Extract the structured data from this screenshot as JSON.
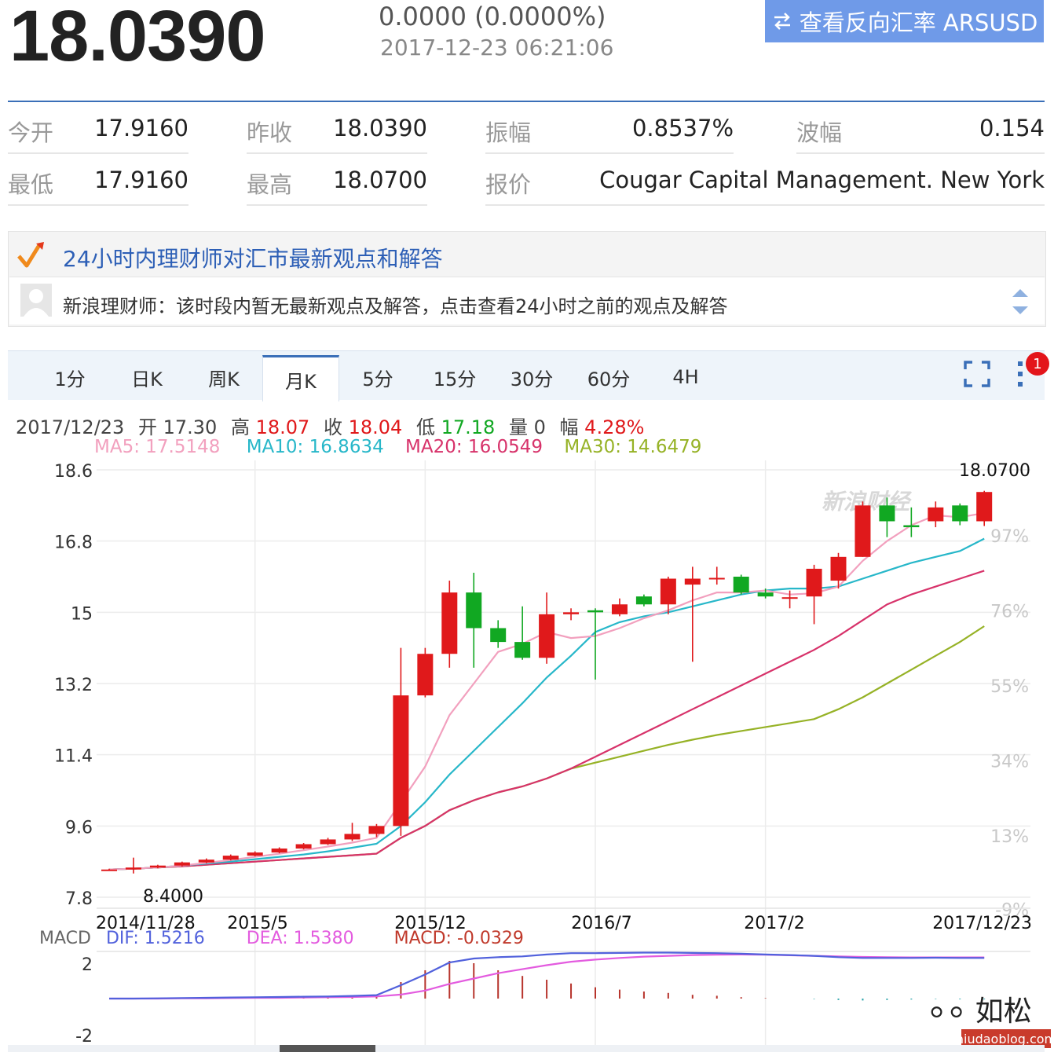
{
  "header": {
    "price": "18.0390",
    "change": "0.0000 (0.0000%)",
    "timestamp": "2017-12-23 06:21:06",
    "reverse_button": "查看反向汇率 ARSUSD",
    "reverse_icon": "swap-arrows-icon"
  },
  "quote": {
    "row1": [
      {
        "label": "今开",
        "value": "17.9160"
      },
      {
        "label": "昨收",
        "value": "18.0390"
      },
      {
        "label": "振幅",
        "value": "0.8537%"
      },
      {
        "label": "波幅",
        "value": "0.154"
      }
    ],
    "row2": [
      {
        "label": "最低",
        "value": "17.9160"
      },
      {
        "label": "最高",
        "value": "18.0700"
      },
      {
        "label": "报价",
        "value": "Cougar Capital Management. New York"
      }
    ]
  },
  "advice": {
    "title": "24小时内理财师对汇市最新观点和解答",
    "text": "新浪理财师：该时段内暂无最新观点及解答，点击查看24小时之前的观点及解答"
  },
  "tabs": [
    "1分",
    "日K",
    "周K",
    "月K",
    "5分",
    "15分",
    "30分",
    "60分",
    "4H"
  ],
  "active_tab": "月K",
  "badge": "1",
  "ohlc": {
    "date": "2017/12/23",
    "open_label": "开",
    "open": "17.30",
    "high_label": "高",
    "high": "18.07",
    "close_label": "收",
    "close": "18.04",
    "low_label": "低",
    "low": "17.18",
    "vol_label": "量",
    "vol": "0",
    "amp_label": "幅",
    "amp": "4.28%"
  },
  "ma": {
    "ma5": "MA5: 17.5148",
    "ma10": "MA10: 16.8634",
    "ma20": "MA20: 16.0549",
    "ma30": "MA30: 14.6479"
  },
  "macd_header": {
    "title": "MACD",
    "dif": "DIF: 1.5216",
    "dea": "DEA: 1.5380",
    "macd": "MACD: -0.0329"
  },
  "watermark": {
    "chart": "新浪财经",
    "corner_name": "如松",
    "corner_url": "niudaoblog.com"
  },
  "colors": {
    "up": "#e0191b",
    "down": "#11a822",
    "ma5": "#f2a0be",
    "ma10": "#27b7c9",
    "ma20": "#d7326a",
    "ma30": "#96b226",
    "dif": "#5161dc",
    "dea": "#e35bdf",
    "accent": "#3a6fb8"
  },
  "chart_data": {
    "type": "candlestick",
    "period": "monthly",
    "y_ticks": [
      "18.6",
      "16.8",
      "15",
      "13.2",
      "11.4",
      "9.6",
      "7.8"
    ],
    "ylim": [
      7.8,
      18.6
    ],
    "pct_ticks": [
      "97%",
      "76%",
      "55%",
      "34%",
      "13%",
      "-9%"
    ],
    "x_labels": [
      "2014/11/28",
      "2015/5",
      "2015/12",
      "2016/7",
      "2017/2",
      "2017/12/23"
    ],
    "max_label": "18.0700",
    "min_label": "8.4000",
    "candles": [
      {
        "o": 8.5,
        "h": 8.52,
        "l": 8.47,
        "c": 8.5
      },
      {
        "o": 8.5,
        "h": 8.8,
        "l": 8.4,
        "c": 8.55
      },
      {
        "o": 8.55,
        "h": 8.62,
        "l": 8.53,
        "c": 8.6
      },
      {
        "o": 8.6,
        "h": 8.7,
        "l": 8.58,
        "c": 8.68
      },
      {
        "o": 8.68,
        "h": 8.78,
        "l": 8.66,
        "c": 8.75
      },
      {
        "o": 8.75,
        "h": 8.88,
        "l": 8.73,
        "c": 8.85
      },
      {
        "o": 8.85,
        "h": 8.96,
        "l": 8.83,
        "c": 8.93
      },
      {
        "o": 8.93,
        "h": 9.06,
        "l": 8.91,
        "c": 9.03
      },
      {
        "o": 9.03,
        "h": 9.17,
        "l": 9.01,
        "c": 9.14
      },
      {
        "o": 9.14,
        "h": 9.3,
        "l": 9.12,
        "c": 9.26
      },
      {
        "o": 9.26,
        "h": 9.68,
        "l": 9.22,
        "c": 9.4
      },
      {
        "o": 9.4,
        "h": 9.65,
        "l": 9.32,
        "c": 9.6
      },
      {
        "o": 9.6,
        "h": 14.1,
        "l": 9.35,
        "c": 12.9
      },
      {
        "o": 12.9,
        "h": 14.1,
        "l": 12.85,
        "c": 13.95
      },
      {
        "o": 13.95,
        "h": 15.8,
        "l": 13.6,
        "c": 15.5
      },
      {
        "o": 15.5,
        "h": 16.0,
        "l": 13.6,
        "c": 14.6
      },
      {
        "o": 14.6,
        "h": 14.8,
        "l": 14.1,
        "c": 14.25
      },
      {
        "o": 14.25,
        "h": 15.15,
        "l": 13.8,
        "c": 13.85
      },
      {
        "o": 13.85,
        "h": 15.5,
        "l": 13.7,
        "c": 14.95
      },
      {
        "o": 14.95,
        "h": 15.1,
        "l": 14.8,
        "c": 15.0
      },
      {
        "o": 15.05,
        "h": 15.1,
        "l": 13.3,
        "c": 15.0
      },
      {
        "o": 14.95,
        "h": 15.35,
        "l": 14.9,
        "c": 15.2
      },
      {
        "o": 15.4,
        "h": 15.45,
        "l": 15.15,
        "c": 15.2
      },
      {
        "o": 15.2,
        "h": 15.9,
        "l": 14.95,
        "c": 15.85
      },
      {
        "o": 15.7,
        "h": 16.15,
        "l": 13.75,
        "c": 15.85
      },
      {
        "o": 15.85,
        "h": 16.15,
        "l": 15.7,
        "c": 15.87
      },
      {
        "o": 15.9,
        "h": 15.95,
        "l": 15.45,
        "c": 15.5
      },
      {
        "o": 15.5,
        "h": 15.6,
        "l": 15.35,
        "c": 15.4
      },
      {
        "o": 15.35,
        "h": 15.55,
        "l": 15.1,
        "c": 15.38
      },
      {
        "o": 15.4,
        "h": 16.2,
        "l": 14.7,
        "c": 16.1
      },
      {
        "o": 15.8,
        "h": 16.5,
        "l": 15.6,
        "c": 16.4
      },
      {
        "o": 16.4,
        "h": 17.8,
        "l": 16.4,
        "c": 17.7
      },
      {
        "o": 17.7,
        "h": 17.9,
        "l": 16.9,
        "c": 17.3
      },
      {
        "o": 17.2,
        "h": 17.65,
        "l": 16.9,
        "c": 17.15
      },
      {
        "o": 17.3,
        "h": 17.8,
        "l": 17.15,
        "c": 17.65
      },
      {
        "o": 17.7,
        "h": 17.75,
        "l": 17.2,
        "c": 17.3
      },
      {
        "o": 17.3,
        "h": 18.07,
        "l": 17.18,
        "c": 18.04
      }
    ],
    "ma5": [
      8.5,
      8.52,
      8.55,
      8.6,
      8.67,
      8.74,
      8.82,
      8.9,
      8.99,
      9.08,
      9.18,
      9.3,
      10.2,
      11.1,
      12.4,
      13.2,
      14.0,
      14.2,
      14.5,
      14.35,
      14.4,
      14.6,
      14.85,
      15.05,
      15.3,
      15.5,
      15.5,
      15.55,
      15.45,
      15.48,
      15.65,
      16.3,
      16.8,
      17.2,
      17.45,
      17.4,
      17.51
    ],
    "ma10": [
      8.5,
      8.52,
      8.55,
      8.6,
      8.65,
      8.7,
      8.76,
      8.82,
      8.88,
      8.96,
      9.05,
      9.15,
      9.6,
      10.2,
      10.9,
      11.5,
      12.1,
      12.7,
      13.35,
      13.9,
      14.5,
      14.75,
      14.9,
      15.0,
      15.15,
      15.3,
      15.45,
      15.55,
      15.6,
      15.6,
      15.65,
      15.85,
      16.05,
      16.25,
      16.4,
      16.55,
      16.86
    ],
    "ma20": [
      8.5,
      8.52,
      8.55,
      8.58,
      8.62,
      8.66,
      8.7,
      8.74,
      8.78,
      8.82,
      8.86,
      8.9,
      9.3,
      9.6,
      10.0,
      10.25,
      10.45,
      10.6,
      10.8,
      11.05,
      11.35,
      11.65,
      11.95,
      12.25,
      12.55,
      12.85,
      13.15,
      13.45,
      13.75,
      14.05,
      14.4,
      14.8,
      15.2,
      15.45,
      15.65,
      15.85,
      16.05
    ],
    "ma30": [
      8.5,
      8.52,
      8.55,
      8.58,
      8.62,
      8.66,
      8.7,
      8.74,
      8.78,
      8.82,
      8.86,
      8.9,
      9.3,
      9.6,
      10.0,
      10.25,
      10.45,
      10.6,
      10.8,
      11.05,
      11.2,
      11.35,
      11.5,
      11.65,
      11.78,
      11.9,
      12.0,
      12.1,
      12.2,
      12.3,
      12.55,
      12.85,
      13.2,
      13.55,
      13.9,
      14.25,
      14.65
    ],
    "macd": {
      "y_ticks": [
        "2",
        "-2"
      ],
      "ylim": [
        -2,
        2
      ],
      "dif": [
        0.0,
        0.0,
        0.01,
        0.02,
        0.03,
        0.04,
        0.05,
        0.06,
        0.07,
        0.08,
        0.1,
        0.13,
        0.5,
        0.9,
        1.35,
        1.5,
        1.55,
        1.58,
        1.65,
        1.7,
        1.7,
        1.71,
        1.72,
        1.72,
        1.71,
        1.7,
        1.68,
        1.65,
        1.63,
        1.6,
        1.55,
        1.52,
        1.52,
        1.52,
        1.53,
        1.52,
        1.52
      ],
      "dea": [
        0.0,
        0.0,
        0.0,
        0.01,
        0.01,
        0.02,
        0.03,
        0.03,
        0.04,
        0.05,
        0.06,
        0.08,
        0.15,
        0.3,
        0.55,
        0.75,
        0.95,
        1.1,
        1.25,
        1.38,
        1.46,
        1.52,
        1.57,
        1.6,
        1.63,
        1.64,
        1.65,
        1.64,
        1.62,
        1.6,
        1.58,
        1.56,
        1.55,
        1.54,
        1.54,
        1.54,
        1.54
      ],
      "hist": [
        0.0,
        0.0,
        0.01,
        0.02,
        0.03,
        0.04,
        0.05,
        0.06,
        0.06,
        0.06,
        0.08,
        0.1,
        0.7,
        1.2,
        1.6,
        1.5,
        1.2,
        0.96,
        0.8,
        0.64,
        0.48,
        0.38,
        0.3,
        0.24,
        0.16,
        0.12,
        0.06,
        0.02,
        0.0,
        -0.02,
        -0.06,
        -0.08,
        -0.06,
        -0.04,
        -0.02,
        -0.03,
        -0.03
      ]
    }
  }
}
